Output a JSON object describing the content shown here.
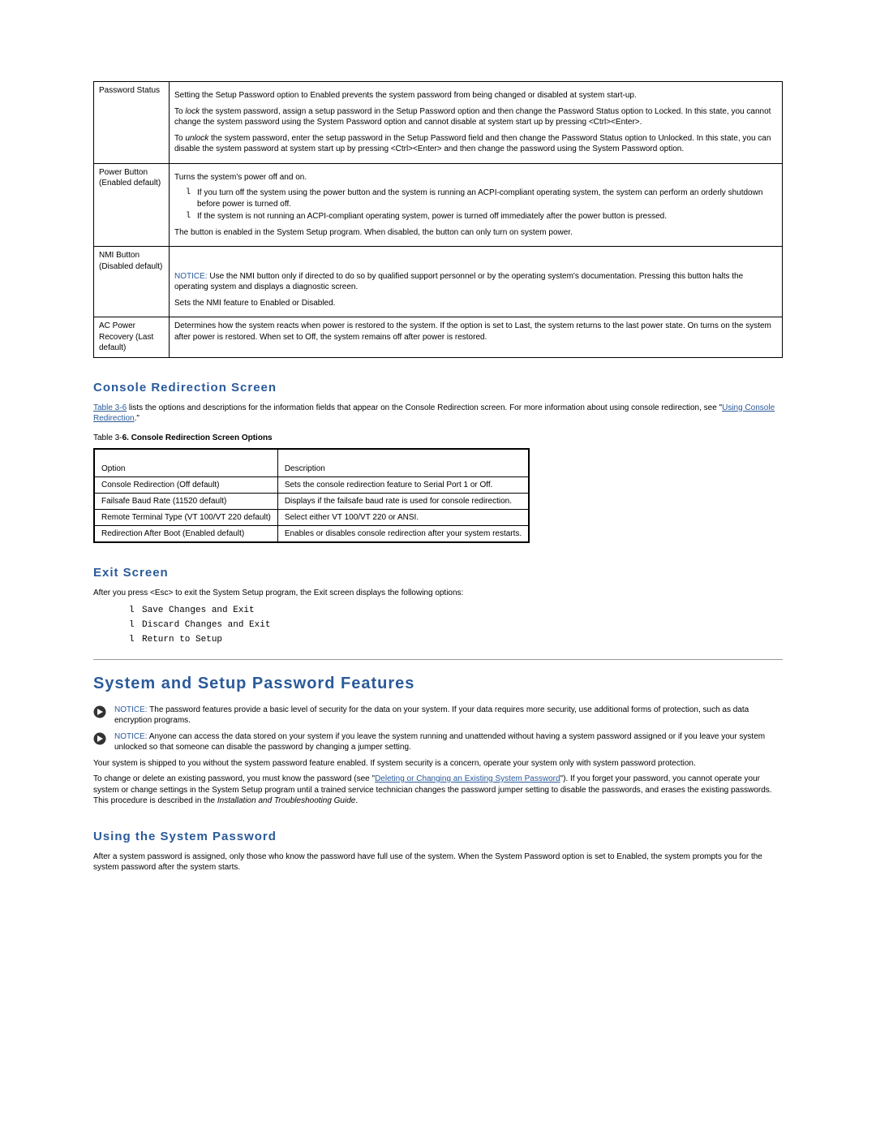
{
  "topTable": {
    "rows": [
      {
        "left": "Password Status",
        "para1": "Setting the Setup Password option to Enabled prevents the system password from being changed or disabled at system start-up.",
        "lockPrefix": "To ",
        "lockItalic": "lock",
        "lockRest": " the system password, assign a setup password in the Setup Password option and then change the Password Status option to Locked. In this state, you cannot change the system password using the System Password option and cannot disable at system start up by pressing <Ctrl><Enter>.",
        "unlockPrefix": "To ",
        "unlockItalic": "unlock",
        "unlockRest": " the system password, enter the setup password in the Setup Password field and then change the Password Status option to Unlocked. In this state, you can disable the system password at system start up by pressing <Ctrl><Enter> and then change the password using the System Password option."
      },
      {
        "left": "Power Button (Enabled default)",
        "para1": "Turns the system's power off and on.",
        "bullet1": "If you turn off the system using the power button and the system is running an ACPI-compliant operating system, the system can perform an orderly shutdown before power is turned off.",
        "bullet2": "If the system is not running an ACPI-compliant operating system, power is turned off immediately after the power button is pressed.",
        "para2": "The button is enabled in the System Setup program. When disabled, the button can only turn on system power."
      },
      {
        "left": "NMI Button (Disabled default)",
        "noticeLabel": "NOTICE:",
        "noticeRest": " Use the NMI button only if directed to do so by qualified support personnel or by the operating system's documentation. Pressing this button halts the operating system and displays a diagnostic screen.",
        "para2": "Sets the NMI feature to Enabled or Disabled."
      },
      {
        "left": "AC Power Recovery (Last default)",
        "para1": "Determines how the system reacts when power is restored to the system. If the option is set to Last, the system returns to the last power state. On turns on the system after power is restored. When set to Off, the system remains off after power is restored."
      }
    ]
  },
  "consoleHeading": "Console Redirection Screen",
  "consoleIntro1a": "Table 3-6",
  "consoleIntro1b": " lists the options and descriptions for the information fields that appear on the Console Redirection screen. For more information about using console redirection, see \"",
  "consoleIntro1c": "Using Console Redirection",
  "consoleIntro1d": ".\"",
  "consoleCaptionPrefix": "Table 3-",
  "consoleCaptionBold": "6. Console Redirection Screen Options",
  "consoleTable": {
    "headers": {
      "col1": "Option",
      "col2": "Description"
    },
    "rows": [
      {
        "opt": "Console Redirection (Off default)",
        "desc": "Sets the console redirection feature to Serial Port 1 or Off."
      },
      {
        "opt": "Failsafe Baud Rate (11520 default)",
        "desc": "Displays if the failsafe baud rate is used for console redirection."
      },
      {
        "opt": "Remote Terminal Type (VT 100/VT 220 default)",
        "desc": "Select either VT 100/VT 220 or ANSI."
      },
      {
        "opt": "Redirection After Boot (Enabled default)",
        "desc": "Enables or disables console redirection after your system restarts."
      }
    ]
  },
  "exitHeading": "Exit Screen",
  "exitIntro": "After you press <Esc> to exit the System Setup program, the Exit screen displays the following options:",
  "exitItems": [
    "Save Changes and Exit",
    "Discard Changes and Exit",
    "Return to Setup"
  ],
  "mainHeading": "System and Setup Password Features",
  "notice1Label": "NOTICE:",
  "notice1Rest": " The password features provide a basic level of security for the data on your system. If your data requires more security, use additional forms of protection, such as data encryption programs.",
  "notice2Label": "NOTICE:",
  "notice2Rest": " Anyone can access the data stored on your system if you leave the system running and unattended without having a system password assigned or if you leave your system unlocked so that someone can disable the password by changing a jumper setting.",
  "para1": "Your system is shipped to you without the system password feature enabled. If system security is a concern, operate your system only with system password protection.",
  "para2a": "To change or delete an existing password, you must know the password (see \"",
  "para2link": "Deleting or Changing an Existing System Password",
  "para2b": "\"). If you forget your password, you cannot operate your system or change settings in the System Setup program until a trained service technician changes the password jumper setting to disable the passwords, and erases the existing passwords. This procedure is described in the ",
  "para2italic": "Installation and Troubleshooting Guide",
  "para2c": ".",
  "usingHeading": "Using the System Password",
  "usingPara": "After a system password is assigned, only those who know the password have full use of the system. When the System Password option is set to Enabled, the system prompts you for the system password after the system starts."
}
